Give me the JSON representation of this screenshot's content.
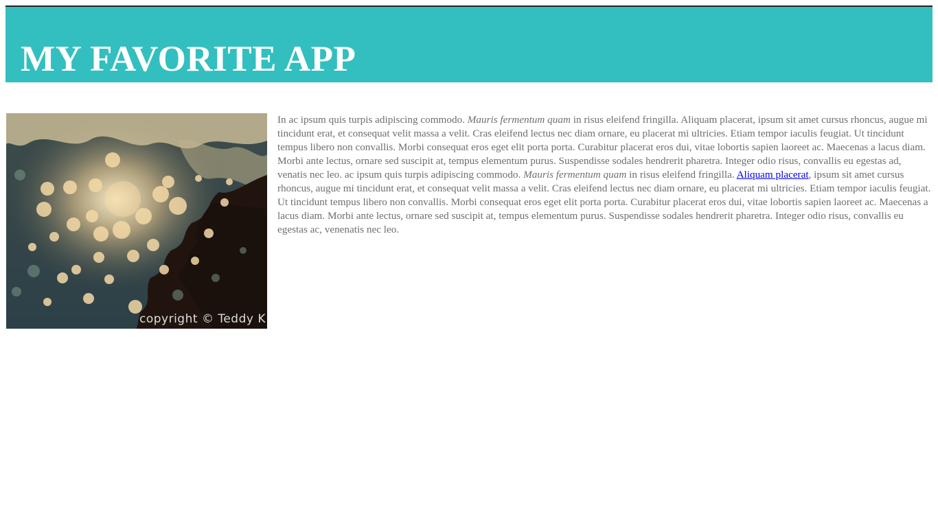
{
  "header": {
    "title": "MY FAVORITE APP",
    "background_color": "#33bfbf"
  },
  "photo": {
    "caption": "copyright © Teddy K"
  },
  "article": {
    "segments": [
      {
        "type": "text",
        "value": "In ac ipsum quis turpis adipiscing commodo. "
      },
      {
        "type": "em",
        "value": "Mauris fermentum quam"
      },
      {
        "type": "text",
        "value": " in risus eleifend fringilla. Aliquam placerat, ipsum sit amet cursus rhoncus, augue mi tincidunt erat, et consequat velit massa a velit. Cras eleifend lectus nec diam ornare, eu placerat mi ultricies. Etiam tempor iaculis feugiat. Ut tincidunt tempus libero non convallis. Morbi consequat eros eget elit porta porta. Curabitur placerat eros dui, vitae lobortis sapien laoreet ac. Maecenas a lacus diam. Morbi ante lectus, ornare sed suscipit at, tempus elementum purus. Suspendisse sodales hendrerit pharetra. Integer odio risus, convallis eu egestas ad, venatis nec leo. ac ipsum quis turpis adipiscing commodo. "
      },
      {
        "type": "em",
        "value": "Mauris fermentum quam"
      },
      {
        "type": "text",
        "value": " in risus eleifend fringilla. "
      },
      {
        "type": "link",
        "value": "Aliquam placerat"
      },
      {
        "type": "text",
        "value": ", ipsum sit amet cursus rhoncus, augue mi tincidunt erat, et consequat velit massa a velit. Cras eleifend lectus nec diam ornare, eu placerat mi ultricies. Etiam tempor iaculis feugiat. Ut tincidunt tempus libero non convallis. Morbi consequat eros eget elit porta porta. Curabitur placerat eros dui, vitae lobortis sapien laoreet ac. Maecenas a lacus diam. Morbi ante lectus, ornare sed suscipit at, tempus elementum purus. Suspendisse sodales hendrerit pharetra. Integer odio risus, convallis eu egestas ac, venenatis nec leo."
      }
    ]
  }
}
